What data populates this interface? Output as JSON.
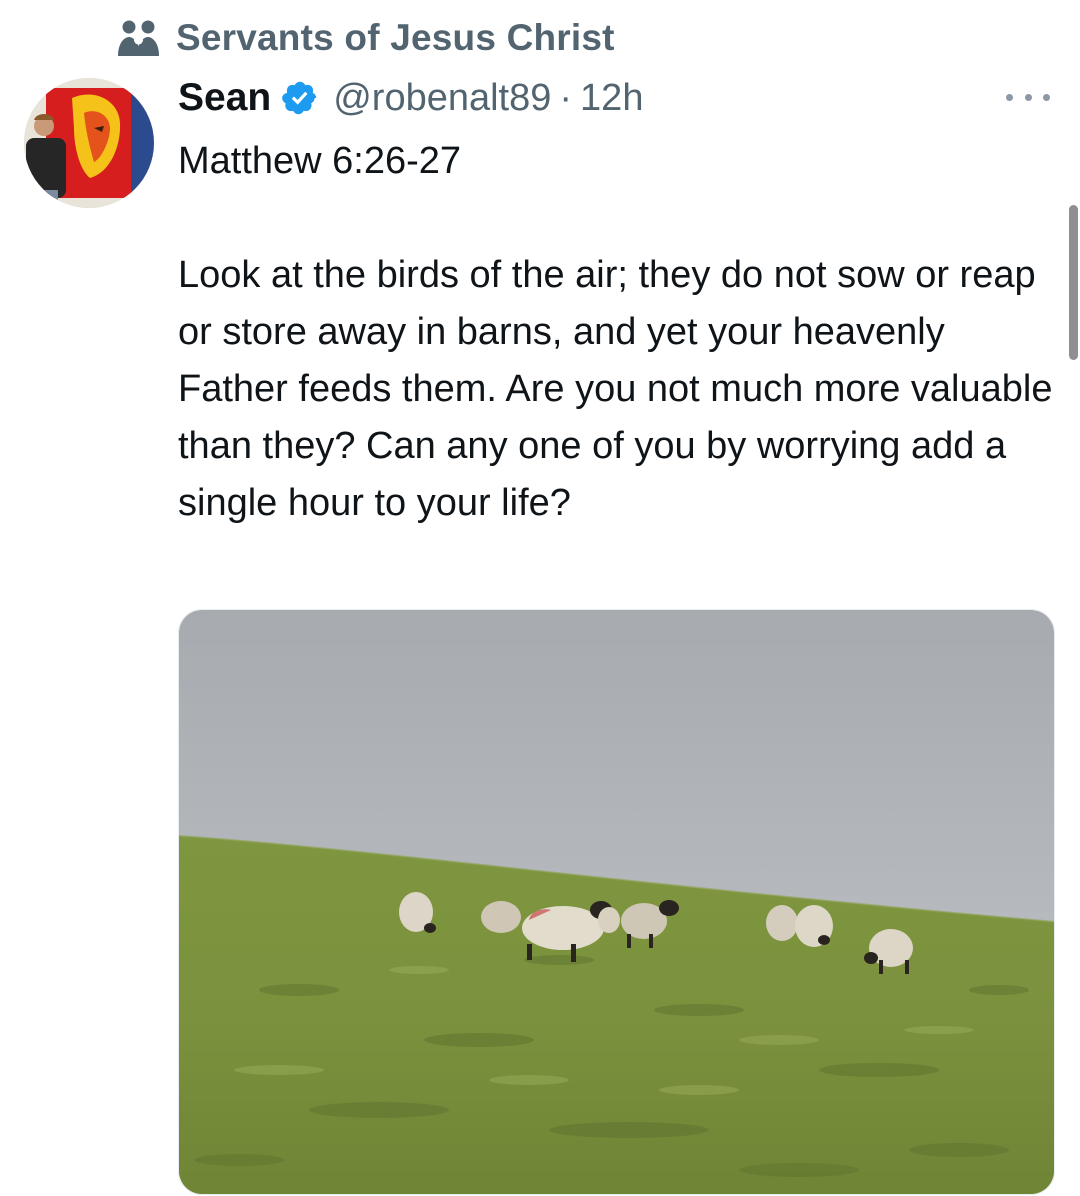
{
  "community": {
    "name": "Servants of Jesus Christ",
    "icon": "community-icon"
  },
  "author": {
    "display_name": "Sean",
    "verified": true,
    "verified_icon": "verified-badge-icon",
    "handle": "@robenalt89",
    "separator": "·",
    "timestamp": "12h"
  },
  "tweet": {
    "text": "Matthew 6:26-27\n\nLook at the birds of the air; they do not sow or reap or store away in barns, and yet your heavenly Father feeds them. Are you not much more valuable than they? Can any one of you by worrying add a single hour to your life?"
  },
  "media": {
    "kind": "photo",
    "subject": "sheep grazing on grassy hillside"
  },
  "colors": {
    "verified_blue": "#1d9bf0",
    "secondary_text": "#536471",
    "primary_text": "#0f1419"
  }
}
